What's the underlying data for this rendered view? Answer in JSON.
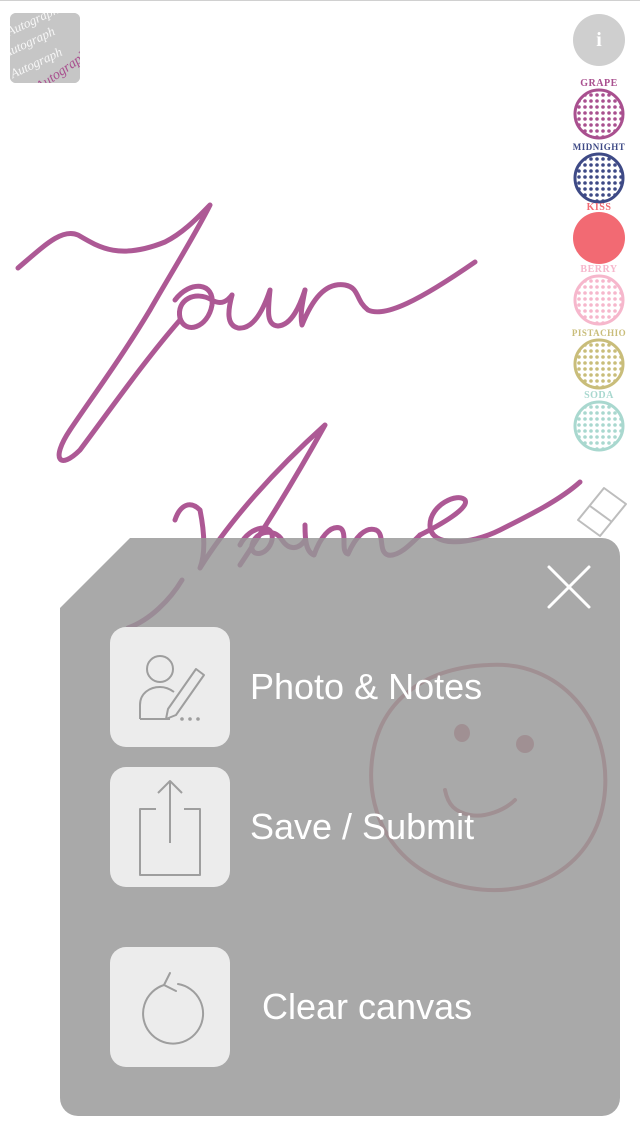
{
  "app": {
    "icon_name": "autograph-app-icon",
    "icon_text": "Autograph"
  },
  "toolbar": {
    "info_label": "i",
    "colors": [
      {
        "name": "GRAPE",
        "hex": "#a9508f",
        "style": "dotted"
      },
      {
        "name": "MIDNIGHT",
        "hex": "#3e4a86",
        "style": "dotted"
      },
      {
        "name": "KISS",
        "hex": "#f26a73",
        "style": "solid"
      },
      {
        "name": "BERRY",
        "hex": "#f6b7cc",
        "style": "dotted"
      },
      {
        "name": "PISTACHIO",
        "hex": "#c9bd7a",
        "style": "dotted"
      },
      {
        "name": "SODA",
        "hex": "#a9d8cf",
        "style": "dotted"
      }
    ],
    "eraser_icon": "eraser-icon"
  },
  "canvas": {
    "drawing": "Your Name signature with smiley face",
    "ink_color": "#a9508f",
    "smiley_color": "#c9657a"
  },
  "menu": {
    "close_icon": "close-icon",
    "items": [
      {
        "label": "Photo & Notes",
        "icon": "contact-edit-icon"
      },
      {
        "label": "Save / Submit",
        "icon": "share-icon"
      },
      {
        "label": "Clear canvas",
        "icon": "refresh-icon"
      }
    ]
  }
}
